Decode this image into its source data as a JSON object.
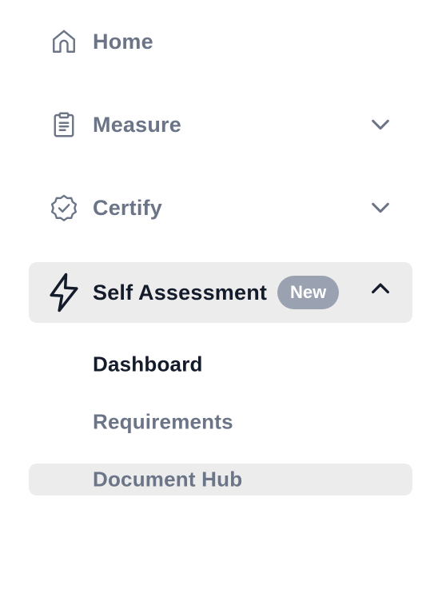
{
  "nav": {
    "items": [
      {
        "label": "Home",
        "icon": "home-icon"
      },
      {
        "label": "Measure",
        "icon": "clipboard-icon",
        "chevron": "chevron-down-icon"
      },
      {
        "label": "Certify",
        "icon": "badge-check-icon",
        "chevron": "chevron-down-icon"
      },
      {
        "label": "Self Assessment",
        "icon": "lightning-icon",
        "badge": "New",
        "chevron": "chevron-up-icon"
      }
    ],
    "sub_items": [
      {
        "label": "Dashboard"
      },
      {
        "label": "Requirements"
      },
      {
        "label": "Document Hub"
      }
    ]
  },
  "colors": {
    "text_muted": "#6b7587",
    "text_active": "#141b2b",
    "highlight_bg": "#ececec",
    "badge_bg": "#9aa2b1"
  }
}
